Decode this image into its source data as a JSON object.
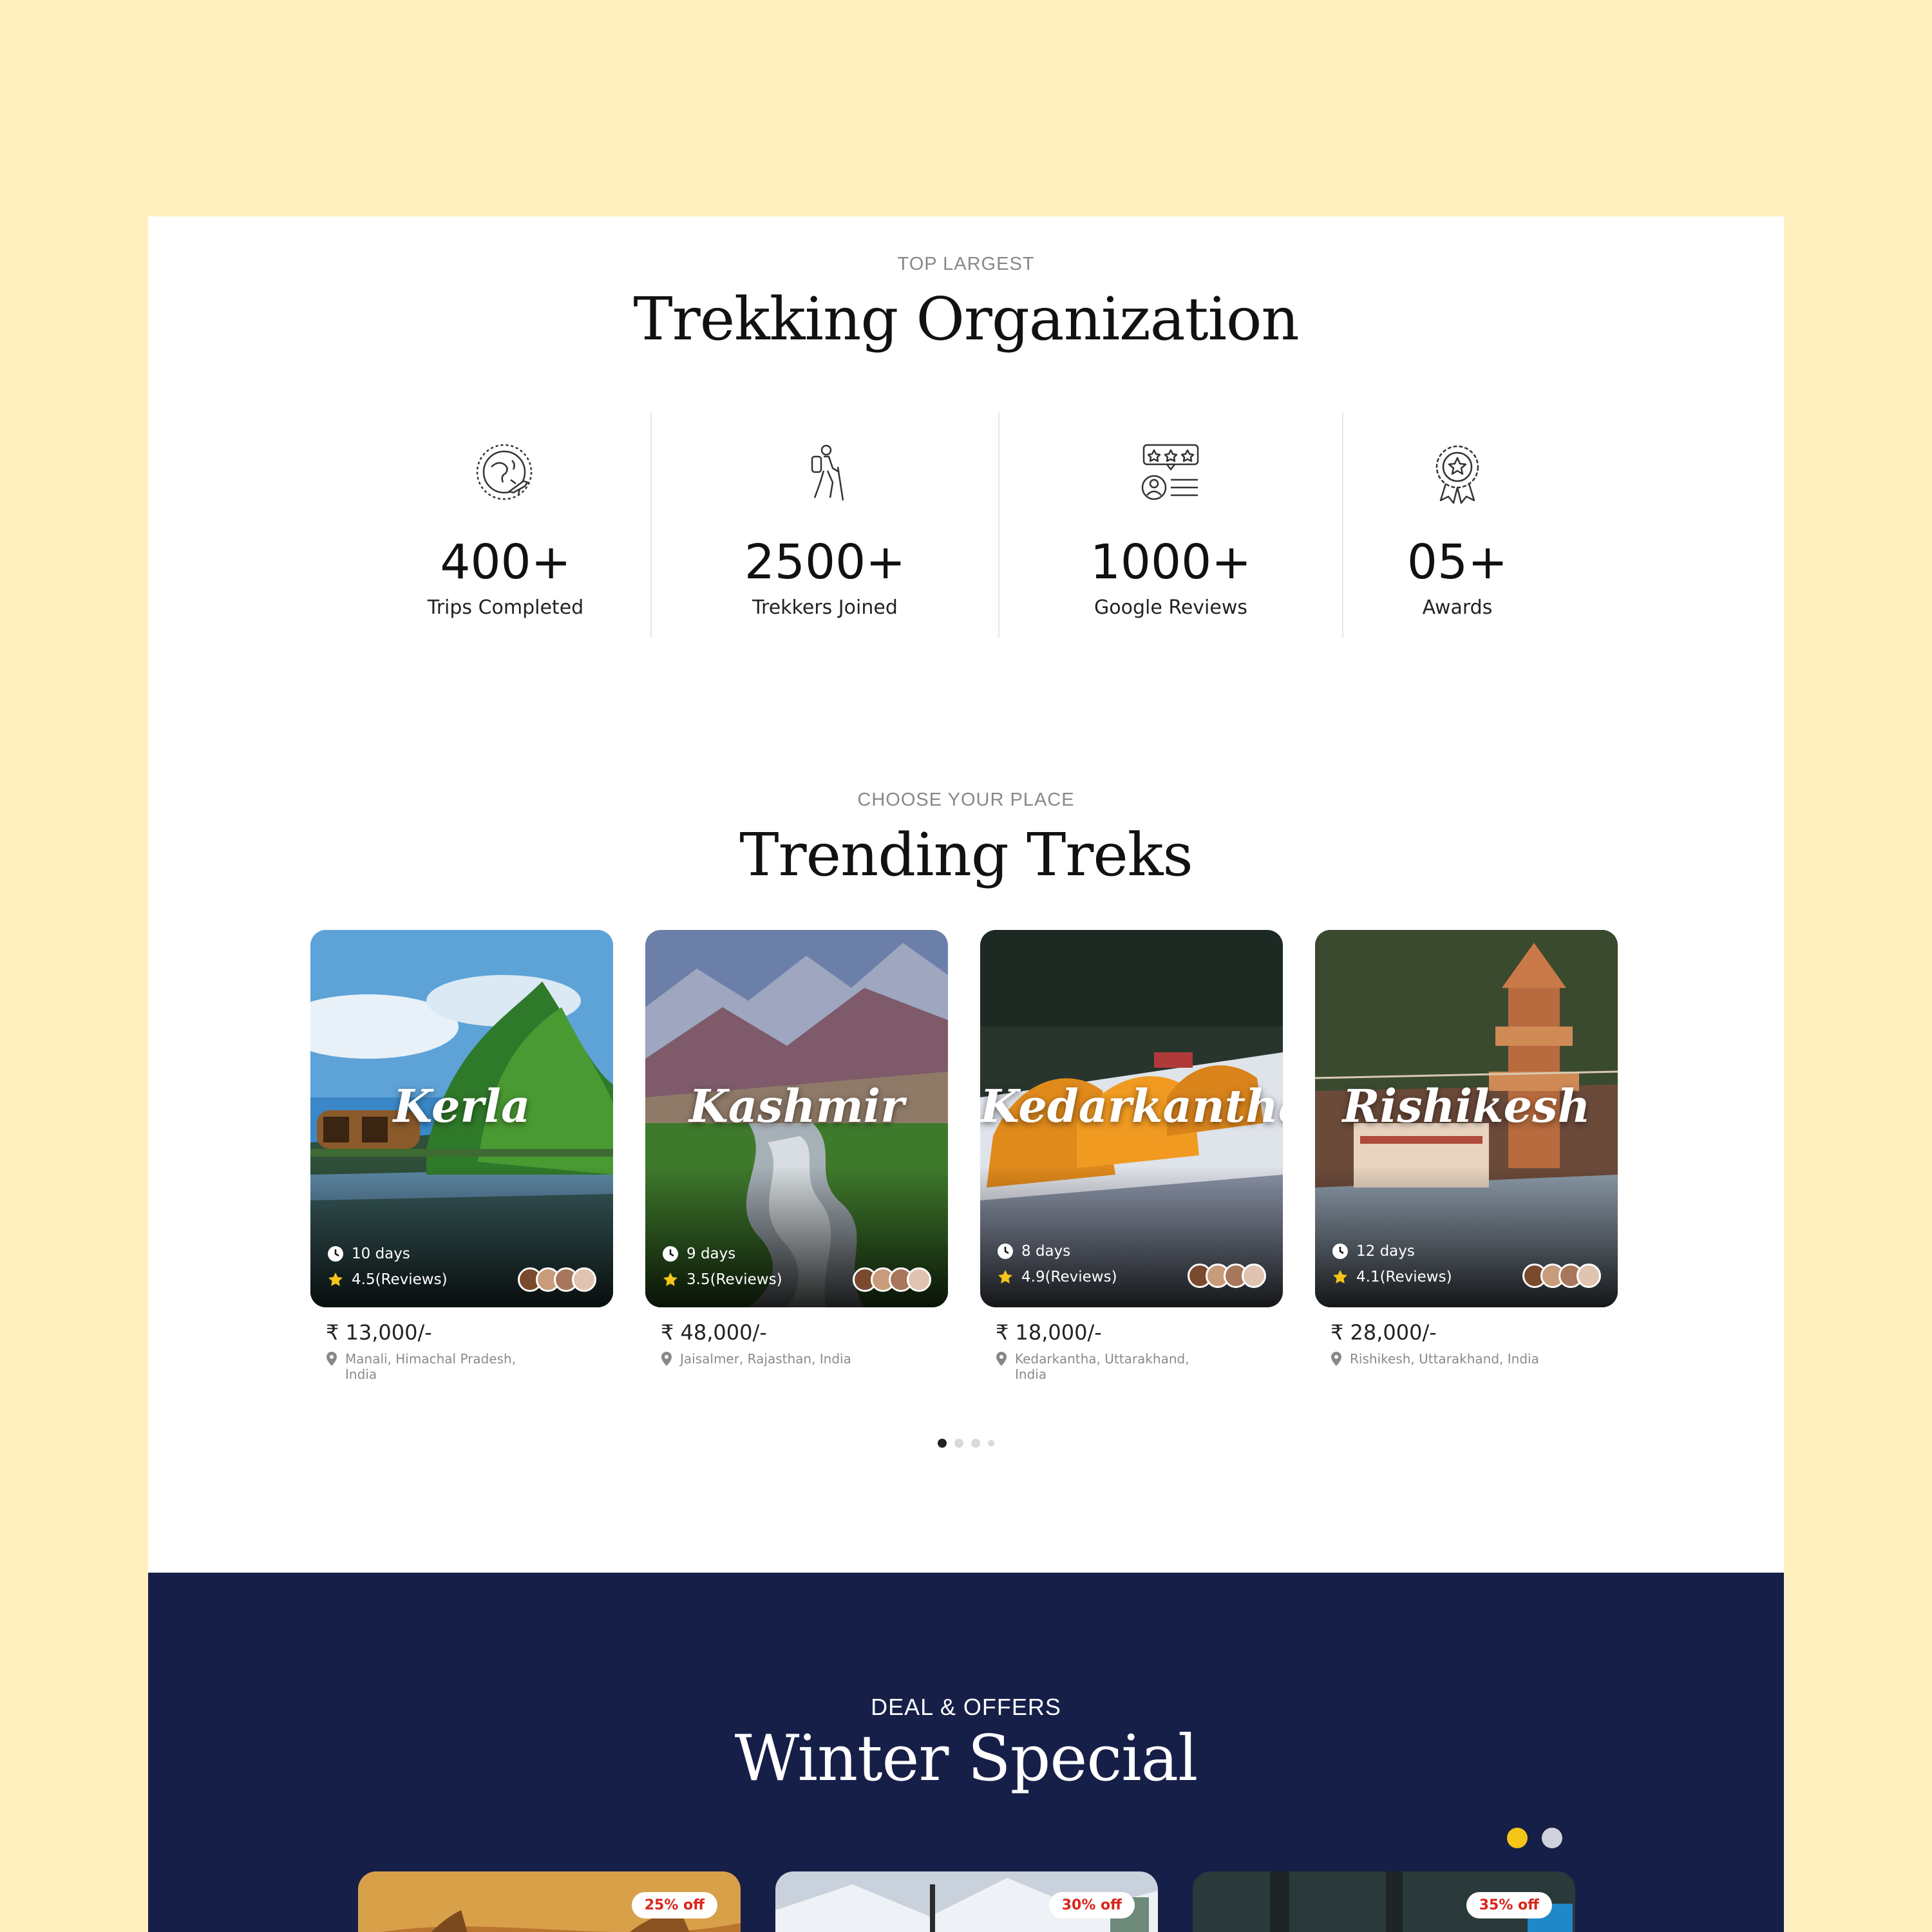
{
  "stats_section": {
    "eyebrow": "TOP LARGEST",
    "title": "Trekking Organization",
    "items": [
      {
        "value": "400+",
        "label": "Trips Completed",
        "icon": "globe-plane-icon"
      },
      {
        "value": "2500+",
        "label": "Trekkers Joined",
        "icon": "hiker-icon"
      },
      {
        "value": "1000+",
        "label": "Google Reviews",
        "icon": "reviews-icon"
      },
      {
        "value": "05+",
        "label": "Awards",
        "icon": "award-badge-icon"
      }
    ]
  },
  "treks_section": {
    "eyebrow": "CHOOSE YOUR PLACE",
    "title": "Trending Treks",
    "cards": [
      {
        "name": "Kerla",
        "days": "10 days",
        "rating": "4.5(Reviews)",
        "price": "₹ 13,000/-",
        "location": "Manali, Himachal Pradesh, India"
      },
      {
        "name": "Kashmir",
        "days": "9 days",
        "rating": "3.5(Reviews)",
        "price": "₹ 48,000/-",
        "location": "Jaisalmer, Rajasthan, India"
      },
      {
        "name": "Kedarkantha",
        "days": "8 days",
        "rating": "4.9(Reviews)",
        "price": "₹ 18,000/-",
        "location": "Kedarkantha, Uttarakhand, India"
      },
      {
        "name": "Rishikesh",
        "days": "12 days",
        "rating": "4.1(Reviews)",
        "price": "₹ 28,000/-",
        "location": "Rishikesh, Uttarakhand, India"
      }
    ],
    "pagination": {
      "total": 4,
      "active": 1
    }
  },
  "winter_section": {
    "eyebrow": "DEAL & OFFERS",
    "title": "Winter Special",
    "pagination": {
      "total": 2,
      "active": 1
    },
    "deals": [
      {
        "badge": "25% off"
      },
      {
        "badge": "30% off"
      },
      {
        "badge": "35% off"
      }
    ]
  },
  "colors": {
    "page_background": "#FFEFBF",
    "winter_background": "#161F48",
    "accent_yellow": "#F5C518",
    "badge_red": "#D9261C"
  }
}
